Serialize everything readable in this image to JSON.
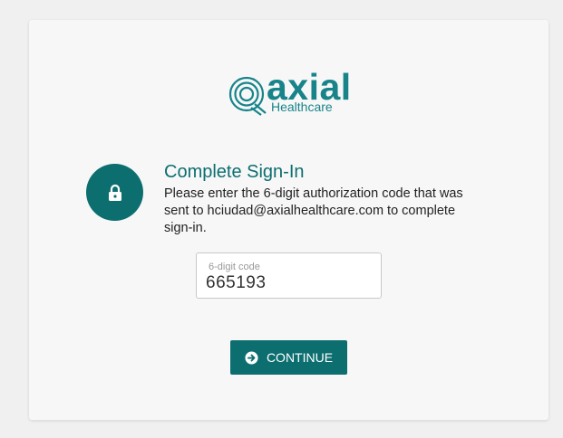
{
  "brand": {
    "wordmark": "axial",
    "subtitle": "Healthcare",
    "color": "#18848a"
  },
  "signin": {
    "title": "Complete Sign-In",
    "description": "Please enter the 6-digit authorization code that was sent to hciudad@axialhealthcare.com to complete sign-in.",
    "icon": "lock-icon",
    "accent_color": "#0d6e70"
  },
  "code_field": {
    "label": "6-digit code",
    "value": "665193"
  },
  "continue_button": {
    "label": "CONTINUE",
    "icon": "arrow-circle-right-icon"
  }
}
